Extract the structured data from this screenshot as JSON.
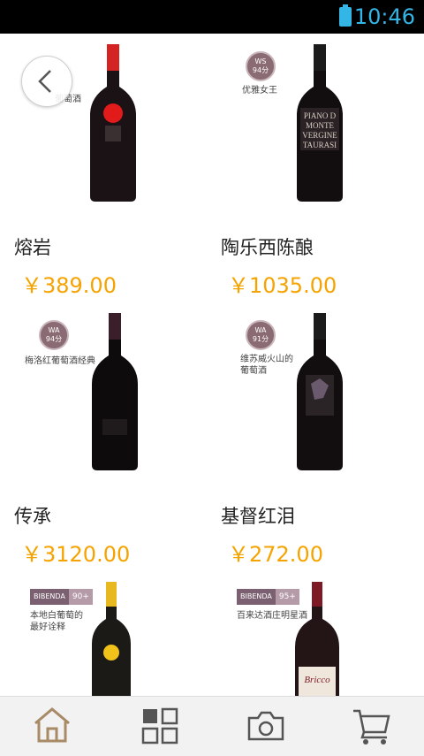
{
  "status": {
    "time": "10:46"
  },
  "products": [
    {
      "name": "熔岩",
      "price": "￥389.00",
      "note": "葡萄酒"
    },
    {
      "name": "陶乐西陈酿",
      "price": "￥1035.00",
      "badge": [
        "WS",
        "94分"
      ],
      "note": "优雅女王",
      "label": "PIANO DI MONTE VERGINE TAURASI"
    },
    {
      "name": "传承",
      "price": "￥3120.00",
      "badge": [
        "WA",
        "94分"
      ],
      "note": "梅洛红葡萄酒经典"
    },
    {
      "name": "基督红泪",
      "price": "￥272.00",
      "badge": [
        "WA",
        "91分"
      ],
      "note_lines": [
        "维苏威火山的",
        "葡萄酒"
      ]
    },
    {
      "bibenda": "BIBENDA",
      "score": "90+",
      "note_lines": [
        "本地白葡萄的",
        "最好诠释"
      ]
    },
    {
      "bibenda": "BIBENDA",
      "score": "95+",
      "note": "百来达酒庄明星酒",
      "label": "Bricco"
    }
  ],
  "colors": {
    "price": "#f5a300",
    "status_accent": "#33b5e5",
    "tab_icon": "#a88a66",
    "tab_icon_dark": "#555555"
  },
  "tabs": [
    {
      "icon": "home-icon"
    },
    {
      "icon": "grid-icon"
    },
    {
      "icon": "camera-icon"
    },
    {
      "icon": "cart-icon"
    }
  ]
}
